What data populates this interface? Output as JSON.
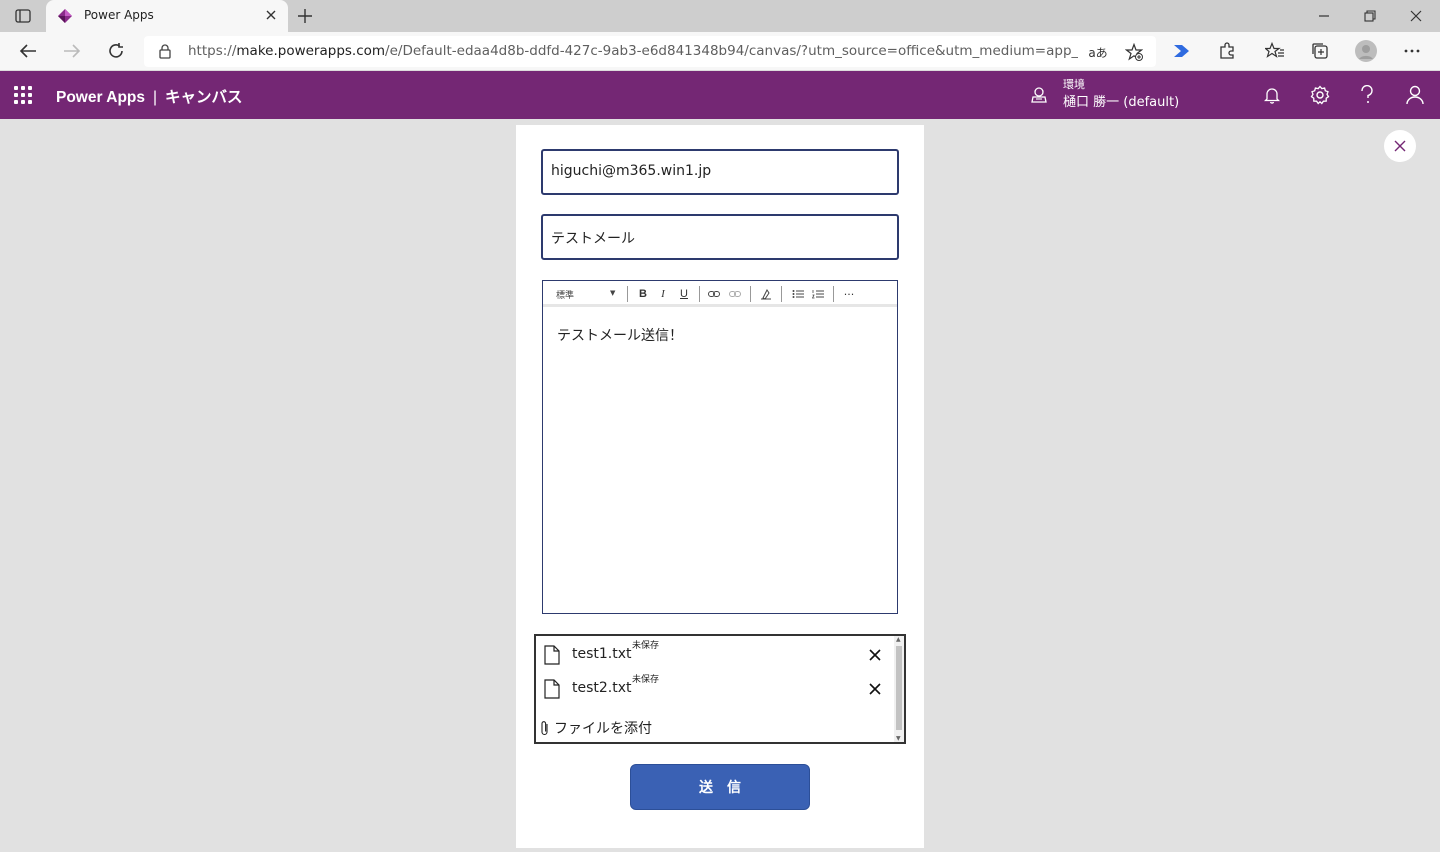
{
  "browser": {
    "tab_title": "Power Apps",
    "url_prefix": "https://",
    "url_host": "make.powerapps.com",
    "url_path": "/e/Default-edaa4d8b-ddfd-427c-9ab3-e6d841348b94/canvas/?utm_source=office&utm_medium=app_launcher...",
    "read_aloud_label": "aあ"
  },
  "header": {
    "app_name": "Power Apps",
    "separator": "|",
    "section": "キャンバス",
    "environment_label": "環境",
    "environment_value": "樋口 勝一 (default)",
    "brand_color": "#742774"
  },
  "form": {
    "to_value": "higuchi@m365.win1.jp",
    "subject_value": "テストメール",
    "editor": {
      "style_select": "標準",
      "body_text": "テストメール送信！"
    },
    "attachments": [
      {
        "name": "test1.txt",
        "status": "未保存"
      },
      {
        "name": "test2.txt",
        "status": "未保存"
      }
    ],
    "attach_label": "ファイルを添付",
    "send_label": "送信",
    "send_color": "#3a61b4"
  }
}
